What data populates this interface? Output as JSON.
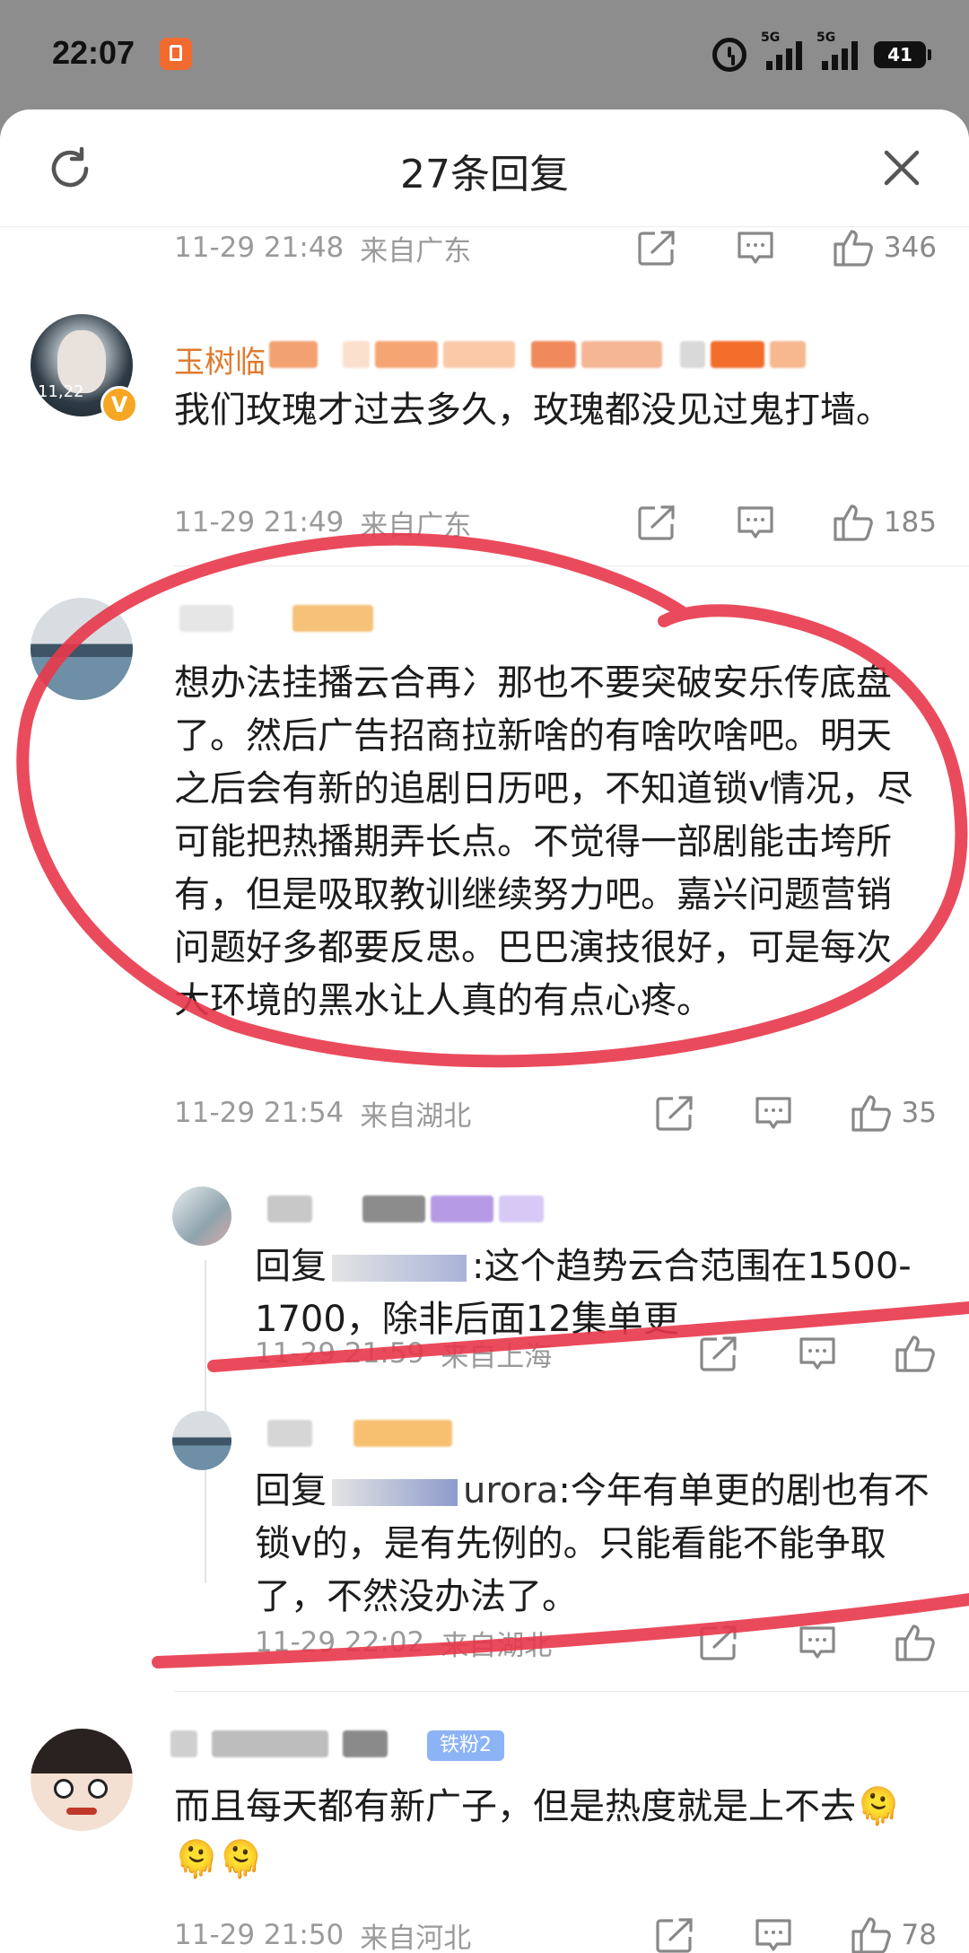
{
  "status_bar": {
    "time": "22:07",
    "network_labels": [
      "5G",
      "5G"
    ],
    "battery": "41"
  },
  "header": {
    "title": "27条回复",
    "refresh_icon": "refresh-icon",
    "close_icon": "close-icon"
  },
  "comments": [
    {
      "id": "c0",
      "name": "",
      "text": "",
      "date": "11-29 21:48",
      "location": "来自广东",
      "likes": "346",
      "partial": true
    },
    {
      "id": "c1",
      "name": "玉树临",
      "verified_badge": "V",
      "text": "我们玫瑰才过去多久，玫瑰都没见过鬼打墙。",
      "date": "11-29 21:49",
      "location": "来自广东",
      "likes": "185"
    },
    {
      "id": "c2",
      "name": "",
      "text": "想办法挂播云合再冫那也不要突破安乐传底盘了。然后广告招商拉新啥的有啥吹啥吧。明天之后会有新的追剧日历吧，不知道锁v情况，尽可能把热播期弄长点。不觉得一部剧能击垮所有，但是吸取教训继续努力吧。嘉兴问题营销问题好多都要反思。巴巴演技很好，可是每次大环境的黑水让人真的有点心疼。",
      "date": "11-29 21:54",
      "location": "来自湖北",
      "likes": "35"
    },
    {
      "id": "r1",
      "name": "",
      "text_prefix": "回复",
      "text_suffix": ":这个趋势云合范围在1500-1700，除非后面12集单更",
      "date": "11-29 21:59",
      "location": "来自上海",
      "likes": ""
    },
    {
      "id": "r2",
      "name": "",
      "text_prefix": "回复",
      "text_mid": "urora",
      "text_suffix": ":今年有单更的剧也有不锁v的，是有先例的。只能看能不能争取了，不然没办法了。",
      "date": "11-29 22:02",
      "location": "来自湖北",
      "likes": ""
    },
    {
      "id": "c3",
      "name": "",
      "fan_badge": "铁粉2",
      "text": "而且每天都有新广子，但是热度就是上不去🫠🫠🫠",
      "date": "11-29 21:50",
      "location": "来自河北",
      "likes": "78"
    }
  ],
  "colors": {
    "accent_name": "#e07b2e",
    "meta_gray": "#9a9a9a",
    "red_annotation": "#e8374a"
  }
}
